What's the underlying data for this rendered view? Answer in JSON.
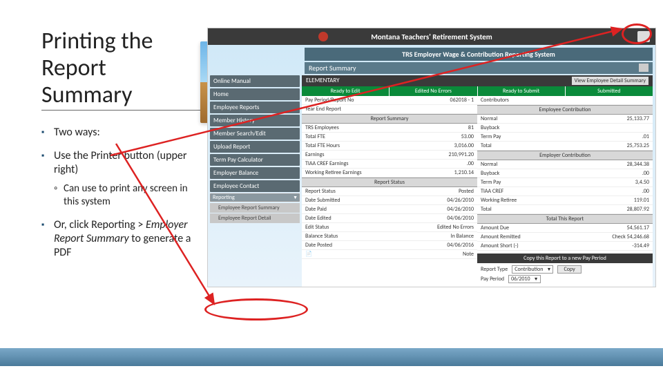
{
  "slide": {
    "title": "Printing the Report Summary",
    "bullets": [
      {
        "text": "Two ways:"
      },
      {
        "text": "Use the Printer button (upper right)",
        "sub": "Can use to print any screen in this system"
      },
      {
        "text_pre": "Or, click Reporting > ",
        "text_em": "Employer Report Summary",
        "text_post": " to generate a PDF"
      }
    ]
  },
  "app": {
    "top_title": "Montana Teachers' Retirement System",
    "sub_title": "TRS Employer Wage & Contribution Reporting System",
    "page_heading": "Report Summary",
    "school_name": "ELEMENTARY",
    "view_button": "View Employee Detail Summary",
    "status_tabs": [
      "Ready to Edit",
      "Edited No Errors",
      "Ready to Submit",
      "Submitted"
    ]
  },
  "nav": {
    "items": [
      "Online Manual",
      "Home",
      "Employee Reports",
      "Member History",
      "Member Search/Edit",
      "Upload Report",
      "Term Pay Calculator",
      "Employer Balance",
      "Employee Contact"
    ],
    "active": "Reporting",
    "subs": [
      "Employee Report Summary",
      "Employee Report Detail"
    ]
  },
  "left_block": {
    "header": "",
    "rows": [
      {
        "k": "Pay Period/Report No",
        "v": "062018 - 1"
      },
      {
        "k": "Year End Report",
        "v": ""
      }
    ],
    "sum_header": "Report Summary",
    "sum_rows": [
      {
        "k": "TRS Employees",
        "v": "81"
      },
      {
        "k": "Total FTE",
        "v": "53.00"
      },
      {
        "k": "Total FTE Hours",
        "v": "3,016.00"
      },
      {
        "k": "Earnings",
        "v": "210,991.20"
      },
      {
        "k": "TIAA CREF Earnings",
        "v": ".00"
      },
      {
        "k": "Working Retiree Earnings",
        "v": "1,210.14"
      }
    ],
    "status_header": "Report Status",
    "status_rows": [
      {
        "k": "Report Status",
        "v": "Posted"
      },
      {
        "k": "Date Submitted",
        "v": "04/26/2010"
      },
      {
        "k": "Date Paid",
        "v": "04/26/2010"
      },
      {
        "k": "Date Edited",
        "v": "04/06/2010"
      },
      {
        "k": "Edit Status",
        "v": "Edited No Errors"
      },
      {
        "k": "Balance Status",
        "v": "In Balance"
      },
      {
        "k": "Date Posted",
        "v": "04/06/2016"
      }
    ],
    "note": "Note"
  },
  "right_block": {
    "contrib_header": "Contributors",
    "emp_header": "Employee Contribution",
    "emp_rows": [
      {
        "k": "Normal",
        "v": "25,133.77"
      },
      {
        "k": "Buyback",
        "v": ""
      },
      {
        "k": "Term Pay",
        "v": ".01"
      },
      {
        "k": "Total",
        "v": "25,753.25"
      }
    ],
    "er_header": "Employer Contribution",
    "er_rows": [
      {
        "k": "Normal",
        "v": "28,344.38"
      },
      {
        "k": "Buyback",
        "v": ".00"
      },
      {
        "k": "Term Pay",
        "v": "3,4.50"
      },
      {
        "k": "TIAA CREF",
        "v": ".00"
      },
      {
        "k": "Working Retiree",
        "v": "119.01"
      },
      {
        "k": "Total",
        "v": "28,807.92"
      }
    ],
    "total_header": "Total This Report",
    "total_rows": [
      {
        "k": "Amount Due",
        "v": "54,561.17"
      },
      {
        "k": "Amount Remitted",
        "v": "Check     54,246.68"
      },
      {
        "k": "Amount Short (-)",
        "v": "-314.49"
      }
    ]
  },
  "copy": {
    "header": "Copy this Report to a new Pay Period",
    "type_label": "Report Type",
    "type_value": "Contribution",
    "period_label": "Pay Period",
    "period_value": "06/2010",
    "button": "Copy"
  }
}
